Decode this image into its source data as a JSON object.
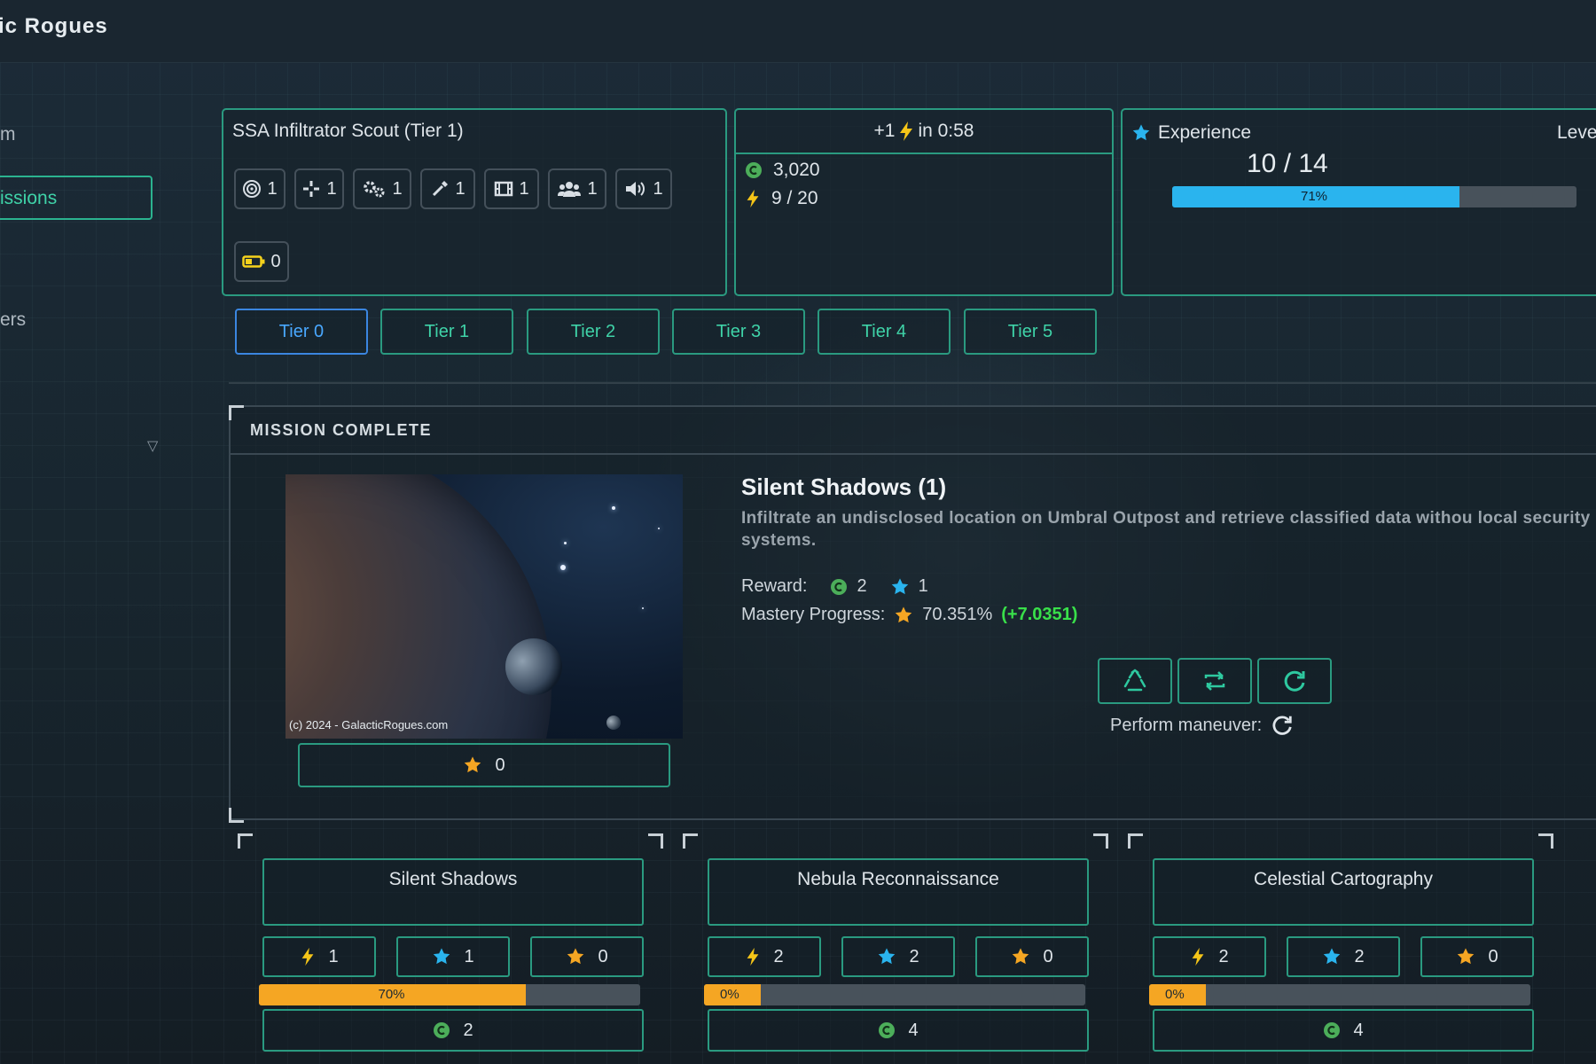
{
  "app": {
    "title": "ic Rogues"
  },
  "sidebar": {
    "items": [
      {
        "label": "m"
      },
      {
        "label": "issions"
      },
      {
        "label": "ers"
      }
    ]
  },
  "ship": {
    "title": "SSA Infiltrator Scout (Tier 1)",
    "stats": [
      {
        "icon": "target-icon",
        "value": "1"
      },
      {
        "icon": "crosshair-icon",
        "value": "1"
      },
      {
        "icon": "gears-icon",
        "value": "1"
      },
      {
        "icon": "dropper-icon",
        "value": "1"
      },
      {
        "icon": "film-icon",
        "value": "1"
      },
      {
        "icon": "users-icon",
        "value": "1"
      },
      {
        "icon": "volume-icon",
        "value": "1"
      },
      {
        "icon": "battery-icon",
        "value": "0"
      }
    ]
  },
  "energy": {
    "regen_prefix": "+1",
    "regen_suffix": "in 0:58",
    "credits": "3,020",
    "energy": "9 / 20"
  },
  "experience": {
    "label": "Experience",
    "level_label": "Leve",
    "value": "10 / 14",
    "percent_label": "71%",
    "fraction": 0.71
  },
  "tiers": [
    {
      "label": "Tier 0",
      "active": true
    },
    {
      "label": "Tier 1",
      "active": false
    },
    {
      "label": "Tier 2",
      "active": false
    },
    {
      "label": "Tier 3",
      "active": false
    },
    {
      "label": "Tier 4",
      "active": false
    },
    {
      "label": "Tier 5",
      "active": false
    }
  ],
  "mission": {
    "header": "MISSION COMPLETE",
    "title": "Silent Shadows (1)",
    "description": "Infiltrate an undisclosed location on Umbral Outpost and retrieve classified data withou local security systems.",
    "image_credit": "(c) 2024 - GalacticRogues.com",
    "image_mastery": "0",
    "reward_label": "Reward:",
    "reward_credits": "2",
    "reward_xp": "1",
    "mastery_label": "Mastery Progress:",
    "mastery_value": "70.351%",
    "mastery_gain": "(+7.0351)",
    "maneuver_label": "Perform maneuver:"
  },
  "cards": [
    {
      "name": "Silent Shadows",
      "energy": "1",
      "xp": "1",
      "mastery": "0",
      "progress_label": "70%",
      "progress": 0.7,
      "credits": "2"
    },
    {
      "name": "Nebula Reconnaissance",
      "energy": "2",
      "xp": "2",
      "mastery": "0",
      "progress_label": "0%",
      "progress": 0.0,
      "credits": "4"
    },
    {
      "name": "Celestial Cartography",
      "energy": "2",
      "xp": "2",
      "mastery": "0",
      "progress_label": "0%",
      "progress": 0.0,
      "credits": "4"
    }
  ],
  "colors": {
    "accent": "#2a9a80",
    "accent_text": "#3fd3a8",
    "active_tab": "#3b86e0",
    "energy": "#f5c518",
    "xp": "#2ab4ee",
    "mastery": "#f5a623",
    "credit": "#4cae5a",
    "gain": "#39e04a"
  }
}
